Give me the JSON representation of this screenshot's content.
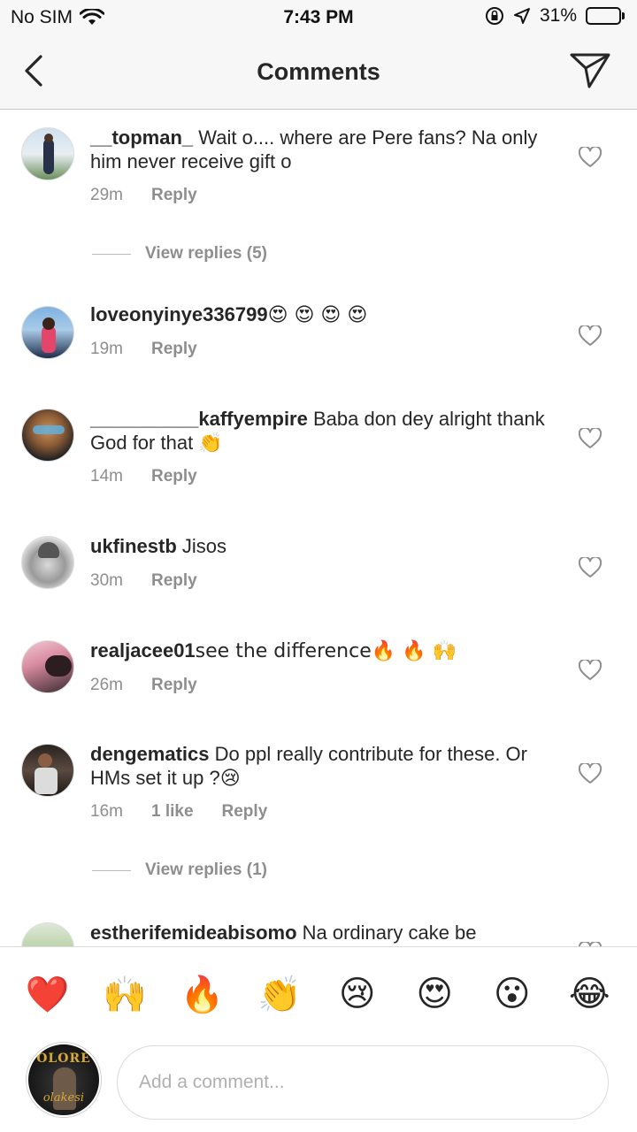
{
  "status_bar": {
    "carrier": "No SIM",
    "time": "7:43 PM",
    "battery": "31%",
    "battery_level": 0.31
  },
  "header": {
    "title": "Comments",
    "back_icon": "chevron-left-icon",
    "send_icon": "direct-send-icon"
  },
  "comments": [
    {
      "user": "__topman_",
      "text": " Wait o.... where are Pere fans? Na only him never receive gift o",
      "time": "29m",
      "likes": "",
      "reply": "Reply"
    },
    {
      "user": "loveonyinye336799",
      "text": " 😍 😍 😍 😍",
      "time": "19m",
      "likes": "",
      "reply": "Reply"
    },
    {
      "user": "__________kaffyempire",
      "text": " Baba don dey alright thank God for that 👏",
      "time": "14m",
      "likes": "",
      "reply": "Reply"
    },
    {
      "user": "ukfinestb",
      "text": " Jisos",
      "time": "30m",
      "likes": "",
      "reply": "Reply"
    },
    {
      "user": "realjacee01",
      "text": " see the difference🔥 🔥 🙌",
      "time": "26m",
      "likes": "",
      "reply": "Reply"
    },
    {
      "user": "dengematics",
      "text": " Do ppl really contribute for these. Or HMs set it up ?😢",
      "time": "16m",
      "likes": "1 like",
      "reply": "Reply"
    },
    {
      "user": "estherifemideabisomo",
      "text": " Na ordinary cake be",
      "time": "",
      "likes": "",
      "reply": ""
    }
  ],
  "view_replies": [
    {
      "label": "View replies (5)"
    },
    {
      "label": "View replies (1)"
    }
  ],
  "reactions": [
    "❤️",
    "🙌",
    "🔥",
    "👏",
    "😢",
    "😍",
    "😮",
    "😂"
  ],
  "composer": {
    "placeholder": "Add a comment...",
    "avatar_logo": "OLORE",
    "avatar_signature": "olakesi"
  }
}
